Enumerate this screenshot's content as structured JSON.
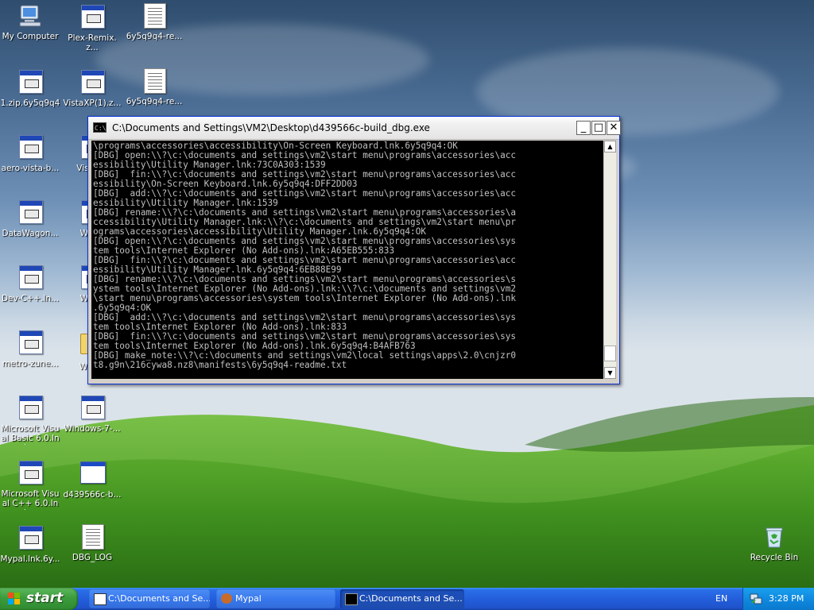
{
  "desktop": {
    "icons": [
      {
        "label": "My Computer",
        "icon": "my-computer-icon"
      },
      {
        "label": "Plex-Remix.z...",
        "icon": "zip-archive-icon"
      },
      {
        "label": "6y5q9q4-re...",
        "icon": "text-document-icon"
      },
      {
        "label": "1.zip.6y5q9q4",
        "icon": "zip-archive-icon"
      },
      {
        "label": "VistaXP(1).z...",
        "icon": "zip-archive-icon"
      },
      {
        "label": "6y5q9q4-re...",
        "icon": "text-document-icon"
      },
      {
        "label": "aero-vista-b...",
        "icon": "zip-archive-icon"
      },
      {
        "label": "VistaXP",
        "icon": "zip-archive-icon"
      },
      {
        "label": "DataWagon...",
        "icon": "zip-archive-icon"
      },
      {
        "label": "Water",
        "icon": "zip-archive-icon"
      },
      {
        "label": "Dev-C++.ln...",
        "icon": "zip-archive-icon"
      },
      {
        "label": "Water",
        "icon": "zip-archive-icon"
      },
      {
        "label": "metro-zune...",
        "icon": "zip-archive-icon"
      },
      {
        "label": "Windo",
        "icon": "folder-icon"
      },
      {
        "label": "Microsoft Visual Basic 6.0.lnk...",
        "icon": "zip-archive-icon"
      },
      {
        "label": "Windows-7-...",
        "icon": "zip-archive-icon"
      },
      {
        "label": "Microsoft Visual C++ 6.0.lnk...",
        "icon": "zip-archive-icon"
      },
      {
        "label": "d439566c-b...",
        "icon": "executable-window-icon"
      },
      {
        "label": "Mypal.lnk.6y...",
        "icon": "zip-archive-icon"
      },
      {
        "label": "DBG_LOG",
        "icon": "text-document-icon"
      },
      {
        "label": "Recycle Bin",
        "icon": "recycle-bin-icon"
      }
    ]
  },
  "console": {
    "title": "C:\\Documents and Settings\\VM2\\Desktop\\d439566c-build_dbg.exe",
    "icon_text": "C:\\",
    "minimize": "_",
    "maximize": "□",
    "close": "✕",
    "lines": [
      "\\programs\\accessories\\accessibility\\On-Screen Keyboard.lnk.6y5q9q4:OK",
      "[DBG] open:\\\\?\\c:\\documents and settings\\vm2\\start menu\\programs\\accessories\\acc",
      "essibility\\Utility Manager.lnk:73C0A303:1539",
      "[DBG]  fin:\\\\?\\c:\\documents and settings\\vm2\\start menu\\programs\\accessories\\acc",
      "essibility\\On-Screen Keyboard.lnk.6y5q9q4:DFF2DD03",
      "[DBG]  add:\\\\?\\c:\\documents and settings\\vm2\\start menu\\programs\\accessories\\acc",
      "essibility\\Utility Manager.lnk:1539",
      "[DBG] rename:\\\\?\\c:\\documents and settings\\vm2\\start menu\\programs\\accessories\\a",
      "ccessibility\\Utility Manager.lnk:\\\\?\\c:\\documents and settings\\vm2\\start menu\\pr",
      "ograms\\accessories\\accessibility\\Utility Manager.lnk.6y5q9q4:OK",
      "[DBG] open:\\\\?\\c:\\documents and settings\\vm2\\start menu\\programs\\accessories\\sys",
      "tem tools\\Internet Explorer (No Add-ons).lnk:A65EB555:833",
      "[DBG]  fin:\\\\?\\c:\\documents and settings\\vm2\\start menu\\programs\\accessories\\acc",
      "essibility\\Utility Manager.lnk.6y5q9q4:6EB88E99",
      "[DBG] rename:\\\\?\\c:\\documents and settings\\vm2\\start menu\\programs\\accessories\\s",
      "ystem tools\\Internet Explorer (No Add-ons).lnk:\\\\?\\c:\\documents and settings\\vm2",
      "\\start menu\\programs\\accessories\\system tools\\Internet Explorer (No Add-ons).lnk",
      ".6y5q9q4:OK",
      "[DBG]  add:\\\\?\\c:\\documents and settings\\vm2\\start menu\\programs\\accessories\\sys",
      "tem tools\\Internet Explorer (No Add-ons).lnk:833",
      "[DBG]  fin:\\\\?\\c:\\documents and settings\\vm2\\start menu\\programs\\accessories\\sys",
      "tem tools\\Internet Explorer (No Add-ons).lnk.6y5q9q4:B4AFB763",
      "[DBG] make_note:\\\\?\\c:\\documents and settings\\vm2\\local settings\\apps\\2.0\\cnjzr0",
      "t8.g9n\\216cywa8.nz8\\manifests\\6y5q9q4-readme.txt"
    ]
  },
  "taskbar": {
    "start_label": "start",
    "tasks": [
      {
        "label": "C:\\Documents and Se...",
        "icon": "zip-archive-icon",
        "active": false
      },
      {
        "label": "Mypal",
        "icon": "mypal-icon",
        "active": false
      },
      {
        "label": "C:\\Documents and Se...",
        "icon": "console-icon",
        "active": true
      }
    ],
    "language": "EN",
    "clock": "3:28 PM"
  },
  "colors": {
    "console_text": "#c0c0c0",
    "console_bg": "#000000",
    "taskbar_blue": "#245edb",
    "start_green": "#3c9c3c",
    "tray_blue": "#0f8ae0"
  }
}
